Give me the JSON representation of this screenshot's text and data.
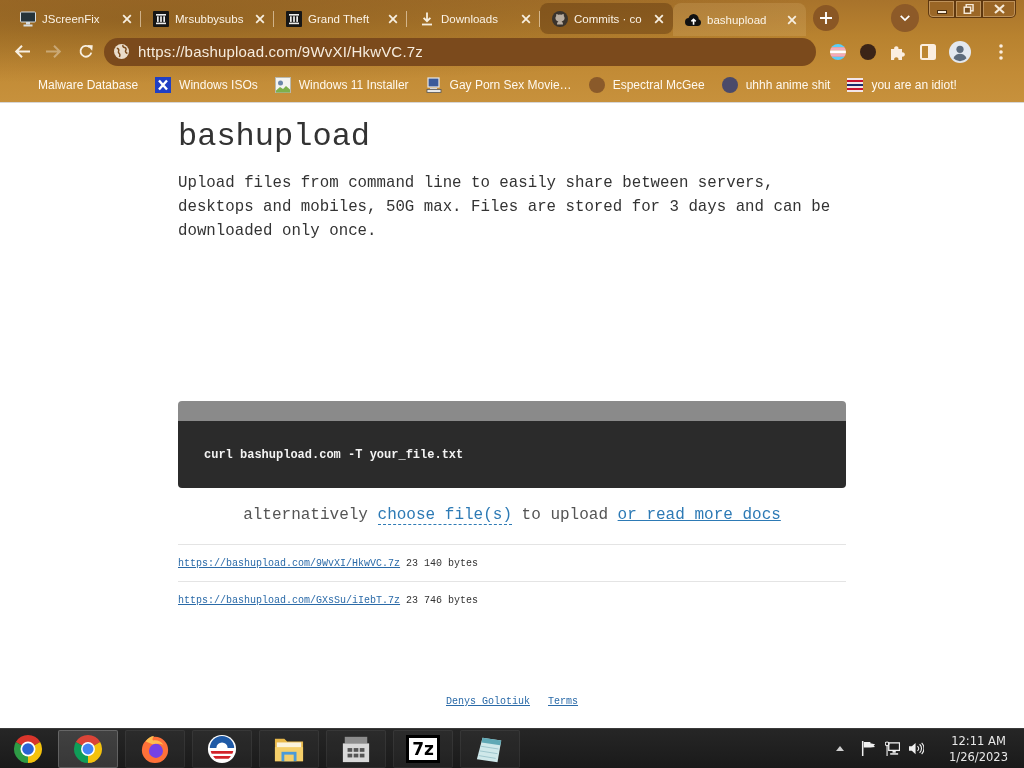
{
  "tabs": [
    {
      "title": "JScreenFix",
      "selected": false,
      "hovered": false
    },
    {
      "title": "Mrsubbysubs",
      "selected": false,
      "hovered": false
    },
    {
      "title": "Grand Theft",
      "selected": false,
      "hovered": false
    },
    {
      "title": "Downloads",
      "selected": false,
      "hovered": false
    },
    {
      "title": "Commits · co",
      "selected": false,
      "hovered": true
    },
    {
      "title": "bashupload",
      "selected": true,
      "hovered": false
    }
  ],
  "toolbar": {
    "url": "https://bashupload.com/9WvXI/HkwVC.7z",
    "forward_disabled": true
  },
  "bookmarks": [
    "Malware Database",
    "Windows ISOs",
    "Windows 11 Installer",
    "Gay Porn Sex Movie…",
    "Espectral McGee",
    "uhhh anime shit",
    "you are an idiot!"
  ],
  "page": {
    "title": "bashupload",
    "description": "Upload files from command line to easily share between servers, desktops and mobiles, 50G max. Files are stored for 3 days and can be downloaded only once.",
    "command": "curl bashupload.com -T your_file.txt",
    "hint": {
      "before": "alternatively",
      "choose_link": "choose file(s)",
      "after": "to upload",
      "docs_link": "or read more docs"
    },
    "files": [
      {
        "url": "https://bashupload.com/9WvXI/HkwVC.7z",
        "size": "23 140 bytes"
      },
      {
        "url": "https://bashupload.com/GXsSu/iIebT.7z",
        "size": "23 746 bytes"
      }
    ],
    "footer_links": [
      "Denys Golotiuk",
      "Terms"
    ]
  },
  "taskbar": {
    "apps": [
      {
        "selected": true
      },
      {
        "selected": false
      },
      {
        "selected": false
      },
      {
        "selected": false
      },
      {
        "selected": false
      },
      {
        "selected": false,
        "label": "7z"
      },
      {
        "selected": false
      }
    ],
    "clock": {
      "time": "12:11 AM",
      "date": "1/26/2023"
    }
  }
}
